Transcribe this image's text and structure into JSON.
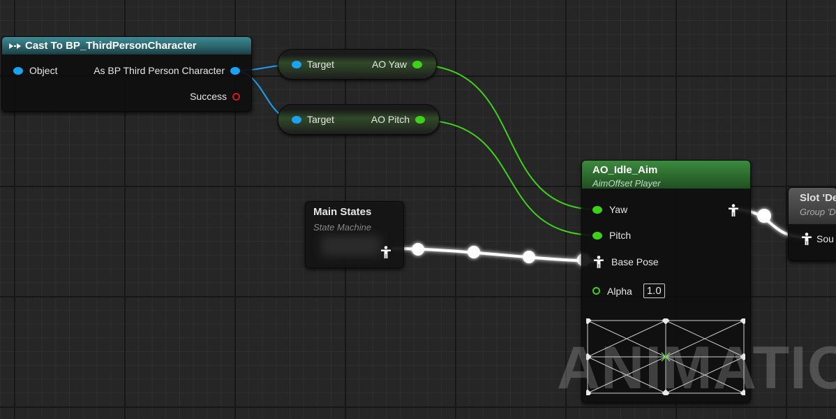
{
  "cast_node": {
    "title": "Cast To BP_ThirdPersonCharacter",
    "pin_object": "Object",
    "pin_as": "As BP Third Person Character",
    "pin_success": "Success"
  },
  "get_yaw": {
    "input": "Target",
    "output": "AO Yaw"
  },
  "get_pitch": {
    "input": "Target",
    "output": "AO Pitch"
  },
  "main_states": {
    "title": "Main States",
    "subtitle": "State Machine"
  },
  "ao_node": {
    "title": "AO_Idle_Aim",
    "subtitle": "AimOffset Player",
    "pin_yaw": "Yaw",
    "pin_pitch": "Pitch",
    "pin_base_pose": "Base Pose",
    "pin_alpha": "Alpha",
    "alpha_value": "1.0"
  },
  "slot_node": {
    "title": "Slot 'De",
    "subtitle": "Group 'D",
    "pin_source": "Sou"
  },
  "watermark": "ANIMATION",
  "colors": {
    "exec_pin": "#ffffff",
    "object_pin": "#1aa3f0",
    "float_pin": "#3ed11a",
    "bool_pin": "#d11a1a",
    "pose_wire": "#ffffff"
  },
  "icons": [
    "exec-arrow-icon",
    "pose-figure-icon"
  ]
}
